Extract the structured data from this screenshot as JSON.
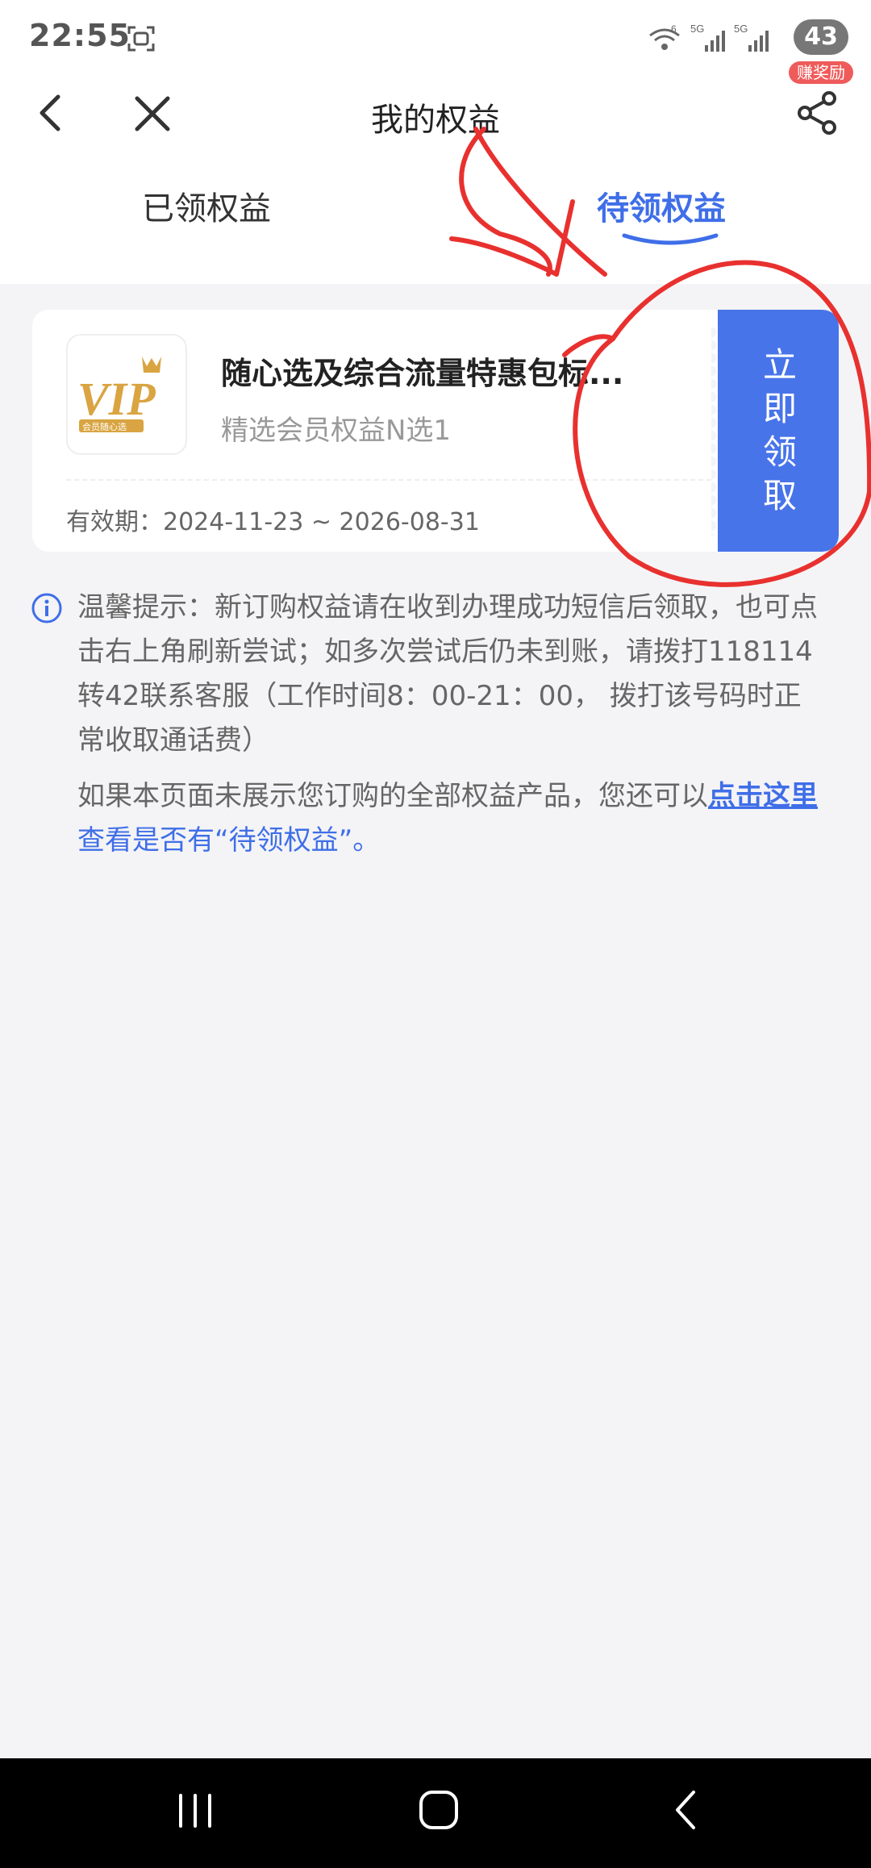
{
  "status_bar": {
    "time": "22:55",
    "battery": "43",
    "signal_labels": [
      "6",
      "5G",
      "5G"
    ],
    "reward_badge": "赚奖励"
  },
  "nav": {
    "title": "我的权益"
  },
  "tabs": [
    {
      "label": "已领权益",
      "active": false
    },
    {
      "label": "待领权益",
      "active": true
    }
  ],
  "card": {
    "logo_text": "VIP",
    "logo_caption": "会员随心选",
    "title": "随心选及综合流量特惠包标...",
    "subtitle": "精选会员权益N选1",
    "validity": "有效期：2024-11-23 ~ 2026-08-31",
    "claim_button": "立即领取"
  },
  "tips": {
    "text1": "温馨提示：新订购权益请在收到办理成功短信后领取，也可点击右上角刷新尝试；如多次尝试后仍未到账，请拨打118114转42联系客服（工作时间8：00-21：00， 拨打该号码时正常收取通话费）",
    "text2_before": "如果本页面未展示您订购的全部权益产品，您还可以",
    "text2_link": "点击这里",
    "text2_after": "查看是否有“待领权益”。"
  },
  "colors": {
    "accent": "#4874ea",
    "annotation": "#e8312f",
    "background": "#f4f4f6"
  }
}
